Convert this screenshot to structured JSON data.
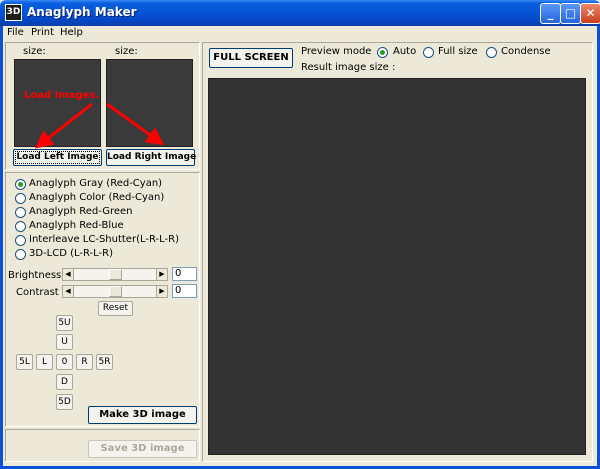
{
  "window": {
    "title": "Anaglyph Maker",
    "icon_text": "3D",
    "controls": [
      "_",
      "□",
      "✕"
    ]
  },
  "menu": [
    "File",
    "Print",
    "Help"
  ],
  "left_panel": {
    "size_label_left": "size:",
    "size_label_right": "size:",
    "overlay_text": "Load Images.",
    "load_left": "Load Left Image",
    "load_right": "Load Right Image",
    "modes": [
      {
        "label": "Anaglyph Gray (Red-Cyan)",
        "checked": true
      },
      {
        "label": "Anaglyph Color (Red-Cyan)",
        "checked": false
      },
      {
        "label": "Anaglyph Red-Green",
        "checked": false
      },
      {
        "label": "Anaglyph Red-Blue",
        "checked": false
      },
      {
        "label": "Interleave LC-Shutter(L-R-L-R)",
        "checked": false
      },
      {
        "label": "3D-LCD (L-R-L-R)",
        "checked": false
      }
    ],
    "brightness_label": "Brightness",
    "brightness_value": "0",
    "contrast_label": "Contrast",
    "contrast_value": "0",
    "reset": "Reset",
    "nav": {
      "up5": "5U",
      "up": "U",
      "left5": "5L",
      "left": "L",
      "center": "0",
      "right": "R",
      "right5": "5R",
      "down": "D",
      "down5": "5D"
    },
    "make_3d": "Make 3D image",
    "save_3d": "Save 3D image"
  },
  "right_panel": {
    "full_screen": "FULL SCREEN",
    "preview_mode_label": "Preview mode",
    "preview_options": [
      {
        "label": "Auto",
        "checked": true
      },
      {
        "label": "Full size",
        "checked": false
      },
      {
        "label": "Condense",
        "checked": false
      }
    ],
    "result_size_label": "Result image size :"
  },
  "colors": {
    "titlebar": "#0655d8",
    "preview_bg": "#333333",
    "annotation": "#ff0000"
  }
}
